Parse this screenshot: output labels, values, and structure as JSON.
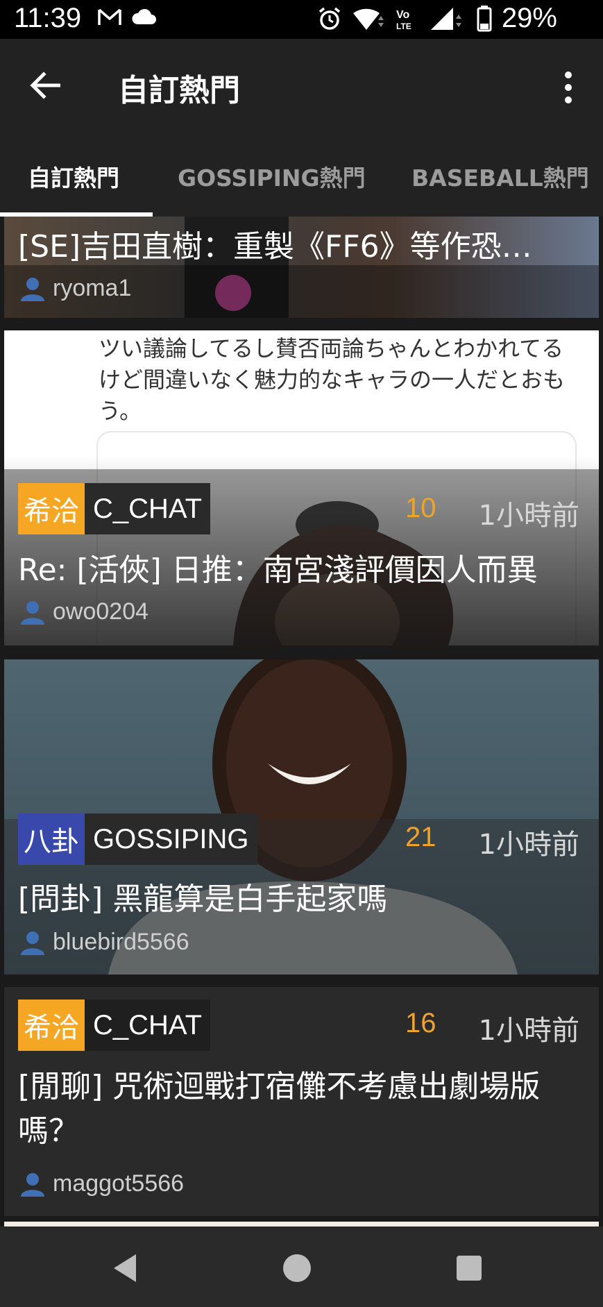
{
  "status_bar": {
    "time": "11:39",
    "battery": "29%",
    "icons": [
      "gmail-icon",
      "cloud-icon",
      "alarm-icon",
      "wifi-icon",
      "volte-icon",
      "signal-icon",
      "battery-icon"
    ]
  },
  "app_bar": {
    "title": "自訂熱門",
    "back_icon": "arrow-left-icon",
    "more_icon": "more-vert-icon"
  },
  "tabs": [
    {
      "label": "自訂熱門",
      "active": true
    },
    {
      "label": "GOSSIPING熱門",
      "active": false
    },
    {
      "label": "BASEBALL熱門",
      "active": false
    }
  ],
  "posts": [
    {
      "title": "[SE]吉田直樹：重製《FF6》等作恐…",
      "author": "ryoma1"
    },
    {
      "image_text": "ツい議論してるし賛否両論ちゃんとわかれてるけど間違いなく魅力的なキャラの一人だとおもう。",
      "board_cn": "希洽",
      "board_en": "C_CHAT",
      "board_color": "#f5a623",
      "push": "10",
      "time": "1小時前",
      "title": "Re: [活俠] 日推：南宮淺評價因人而異",
      "author": "owo0204"
    },
    {
      "board_cn": "八卦",
      "board_en": "GOSSIPING",
      "board_color": "#3949ab",
      "push": "21",
      "time": "1小時前",
      "title": "[問卦] 黑龍算是白手起家嗎",
      "author": "bluebird5566"
    },
    {
      "board_cn": "希洽",
      "board_en": "C_CHAT",
      "board_color": "#f5a623",
      "push": "16",
      "time": "1小時前",
      "title": "[閒聊] 咒術迴戰打宿儺不考慮出劇場版嗎？",
      "author": "maggot5566"
    }
  ],
  "nav_bar": {
    "back": "nav-back-icon",
    "home": "nav-home-icon",
    "recents": "nav-recents-icon"
  }
}
